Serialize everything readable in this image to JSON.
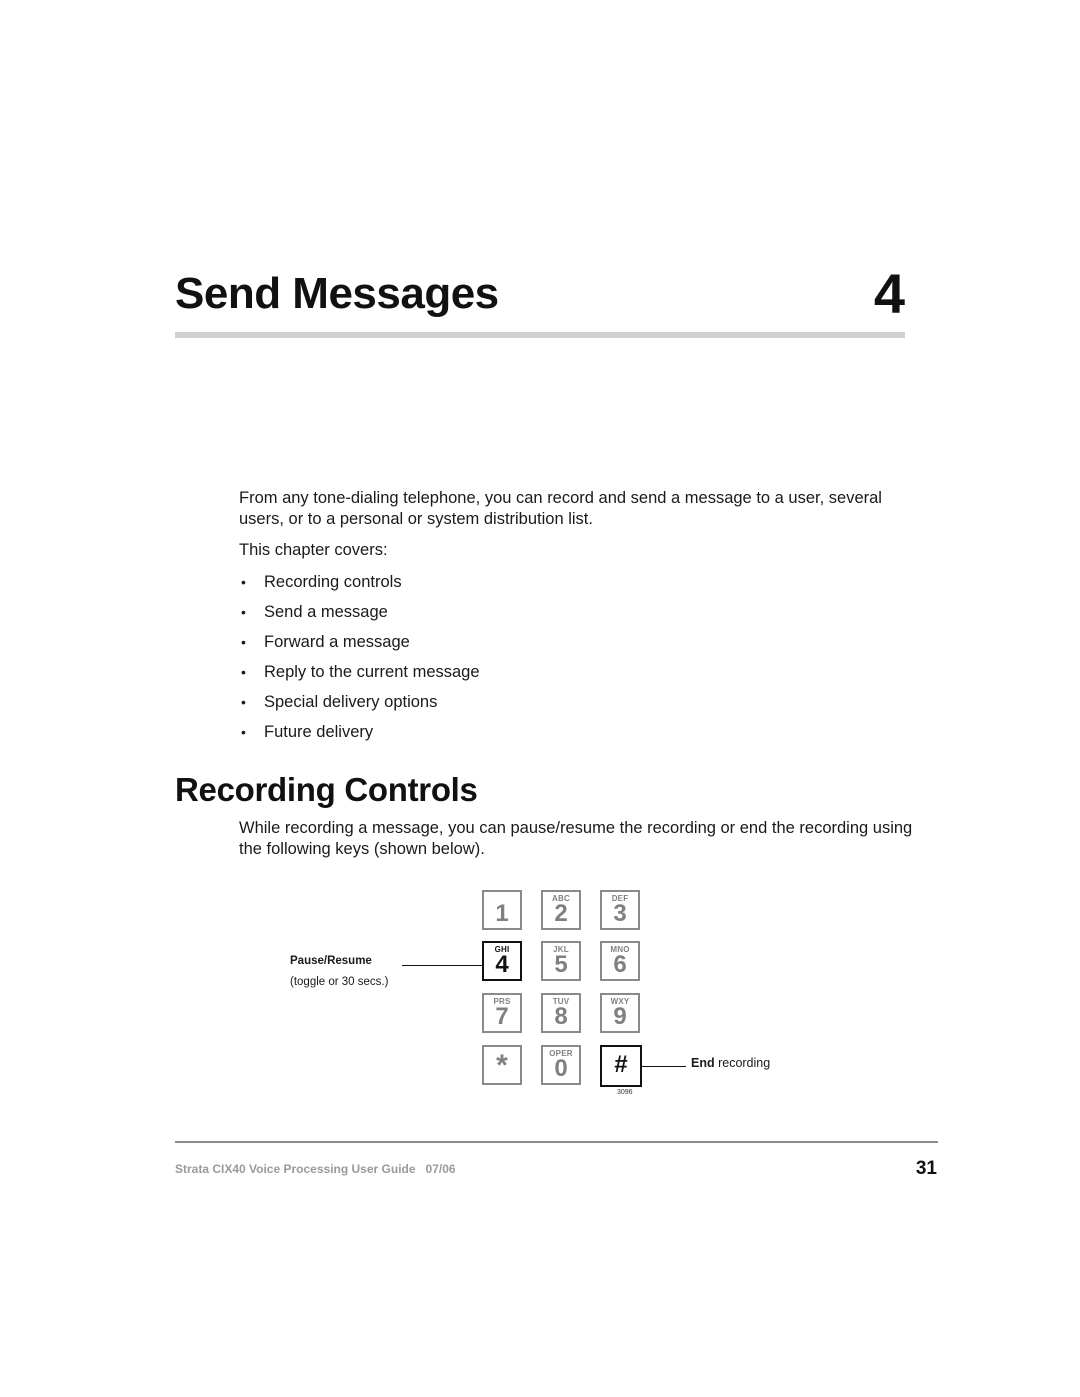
{
  "chapter": {
    "title": "Send Messages",
    "number": "4"
  },
  "intro": {
    "paragraph": "From any tone-dialing telephone, you can record and send a message to a user, several users, or to a personal or system distribution list.",
    "covers_label": "This chapter covers:",
    "bullet_glyph": "•",
    "bullets": [
      "Recording controls",
      "Send a message",
      "Forward a message",
      "Reply to the current message",
      "Special delivery options",
      "Future delivery"
    ]
  },
  "section": {
    "title": "Recording Controls",
    "paragraph": "While recording a message, you can pause/resume the recording or end the recording using the following keys (shown below)."
  },
  "keypad": {
    "keys": [
      {
        "digit": "1",
        "letters": "",
        "highlighted": false
      },
      {
        "digit": "2",
        "letters": "ABC",
        "highlighted": false
      },
      {
        "digit": "3",
        "letters": "DEF",
        "highlighted": false
      },
      {
        "digit": "4",
        "letters": "GHI",
        "highlighted": true
      },
      {
        "digit": "5",
        "letters": "JKL",
        "highlighted": false
      },
      {
        "digit": "6",
        "letters": "MNO",
        "highlighted": false
      },
      {
        "digit": "7",
        "letters": "PRS",
        "highlighted": false
      },
      {
        "digit": "8",
        "letters": "TUV",
        "highlighted": false
      },
      {
        "digit": "9",
        "letters": "WXY",
        "highlighted": false
      },
      {
        "digit": "*",
        "letters": "",
        "highlighted": false
      },
      {
        "digit": "0",
        "letters": "OPER",
        "highlighted": false
      },
      {
        "digit": "#",
        "letters": "",
        "highlighted": true
      }
    ],
    "pause_label": "Pause/Resume",
    "pause_sublabel": "(toggle or 30 secs.)",
    "end_label_bold": "End",
    "end_label_rest": " recording",
    "figure_id": "3096"
  },
  "footer": {
    "guide_title": "Strata CIX40 Voice Processing User Guide",
    "date": "07/06",
    "page_number": "31"
  }
}
